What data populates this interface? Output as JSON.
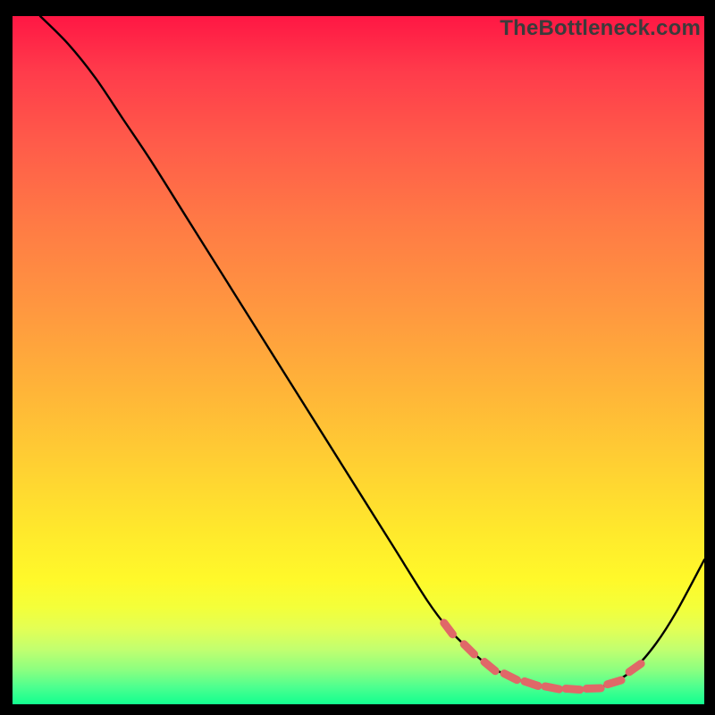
{
  "watermark": "TheBottleneck.com",
  "chart_data": {
    "type": "line",
    "title": "",
    "xlabel": "",
    "ylabel": "",
    "xlim": [
      0,
      100
    ],
    "ylim": [
      0,
      100
    ],
    "grid": false,
    "legend": false,
    "series": [
      {
        "name": "bottleneck-curve",
        "color": "#000000",
        "x": [
          4,
          8,
          12,
          16,
          20,
          25,
          30,
          35,
          40,
          45,
          50,
          55,
          60,
          63,
          66,
          69,
          72,
          75,
          78,
          81,
          84,
          87,
          90,
          93,
          96,
          100
        ],
        "y": [
          100,
          96,
          91,
          85,
          79,
          71,
          63,
          55,
          47,
          39,
          31,
          23,
          15,
          11,
          8,
          5.5,
          4,
          3,
          2.4,
          2.2,
          2.3,
          3.2,
          5.3,
          8.8,
          13.5,
          21
        ]
      }
    ],
    "markers": [
      {
        "name": "dash-band",
        "color": "#e06868",
        "style": "dashed-thick",
        "x": [
          63,
          66,
          69,
          72,
          75,
          78,
          81,
          84,
          87,
          90
        ],
        "y": [
          11,
          8,
          5.5,
          4,
          3,
          2.4,
          2.2,
          2.3,
          3.2,
          5.3
        ]
      }
    ]
  }
}
